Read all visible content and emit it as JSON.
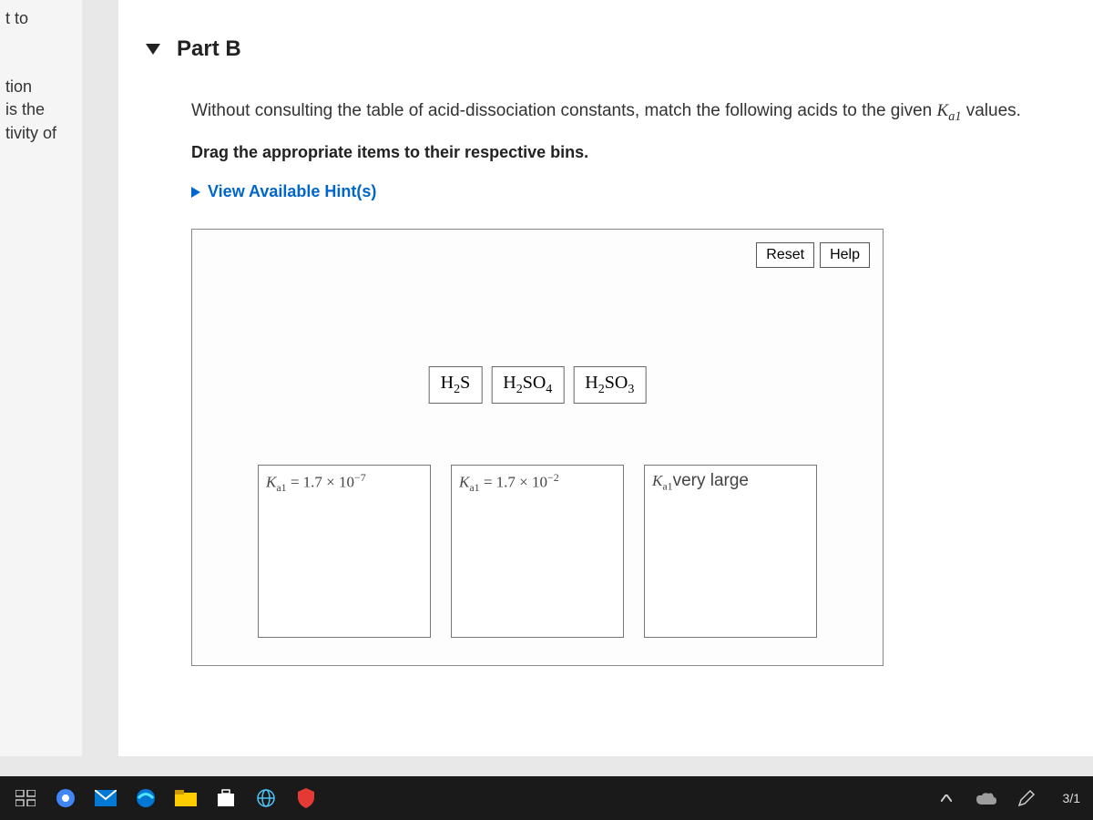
{
  "sidebar": {
    "fragment1": "t to",
    "fragment2a": "tion",
    "fragment2b": "is the",
    "fragment2c": "tivity of"
  },
  "part": {
    "title": "Part B",
    "question_prefix": "Without consulting the table of acid-dissociation constants, match the following acids to the given ",
    "ka_symbol": "K",
    "ka_sub": "a1",
    "question_suffix": " values.",
    "instruction": "Drag the appropriate items to their respective bins.",
    "hints_label": "View Available Hint(s)"
  },
  "activity": {
    "reset_label": "Reset",
    "help_label": "Help",
    "draggables": [
      {
        "formula_main": "H",
        "sub1": "2",
        "tail": "S"
      },
      {
        "formula_main": "H",
        "sub1": "2",
        "tail": "SO",
        "sub2": "4"
      },
      {
        "formula_main": "H",
        "sub1": "2",
        "tail": "SO",
        "sub2": "3"
      }
    ],
    "bins": [
      {
        "ka": "K",
        "ka_sub": "a1",
        "eq": " = 1.7 × 10",
        "exp": "−7"
      },
      {
        "ka": "K",
        "ka_sub": "a1",
        "eq": " = 1.7 × 10",
        "exp": "−2"
      },
      {
        "ka": "K",
        "ka_sub": "a1",
        "large_text": "very large"
      }
    ]
  },
  "taskbar": {
    "icons": [
      "task-view",
      "chrome",
      "mail",
      "edge",
      "file-explorer",
      "store",
      "web",
      "shield"
    ],
    "date": "3/1"
  }
}
